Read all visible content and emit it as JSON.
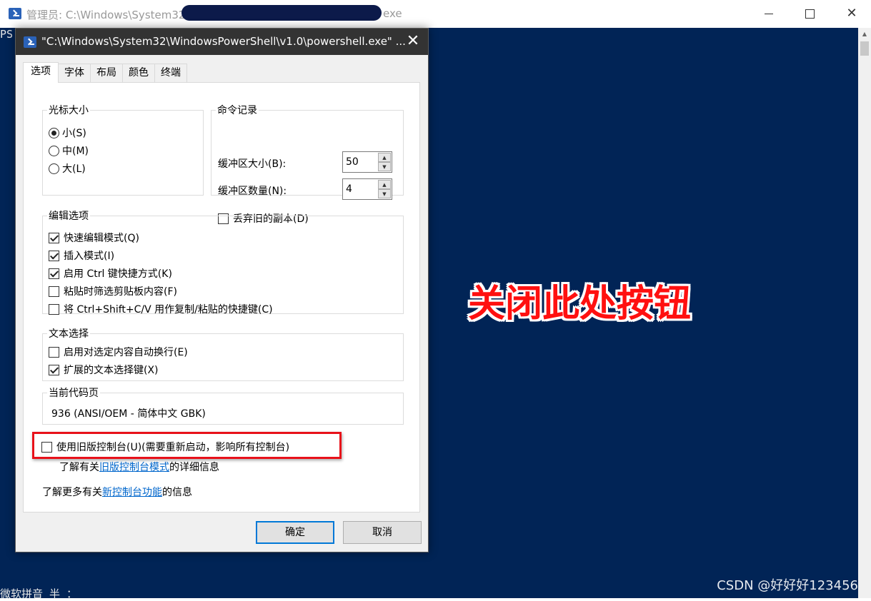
{
  "outer_window": {
    "title_prefix": "管理员: C:\\Windows\\System32",
    "title_suffix": "exe",
    "console_prompt": "PS",
    "console_bottom_line": "微软拼音 半 ：",
    "icon": "powershell-icon"
  },
  "annotation": {
    "callout_text": "关闭此处按钮",
    "color": "#e8111a"
  },
  "watermark": "CSDN @好好好123456",
  "dialog": {
    "title": "\"C:\\Windows\\System32\\WindowsPowerShell\\v1.0\\powershell.exe\" ...",
    "close_glyph": "✕",
    "tabs": [
      {
        "label": "选项",
        "active": true
      },
      {
        "label": "字体",
        "active": false
      },
      {
        "label": "布局",
        "active": false
      },
      {
        "label": "颜色",
        "active": false
      },
      {
        "label": "终端",
        "active": false
      }
    ],
    "cursor_size": {
      "legend": "光标大小",
      "options": [
        {
          "label": "小(S)",
          "selected": true
        },
        {
          "label": "中(M)",
          "selected": false
        },
        {
          "label": "大(L)",
          "selected": false
        }
      ]
    },
    "command_history": {
      "legend": "命令记录",
      "buffer_size_label": "缓冲区大小(B):",
      "buffer_size_value": "50",
      "buffer_count_label": "缓冲区数量(N):",
      "buffer_count_value": "4",
      "discard_label": "丢弃旧的副本(D)",
      "discard_checked": false
    },
    "edit_options": {
      "legend": "编辑选项",
      "items": [
        {
          "label": "快速编辑模式(Q)",
          "checked": true
        },
        {
          "label": "插入模式(I)",
          "checked": true
        },
        {
          "label": "启用 Ctrl 键快捷方式(K)",
          "checked": true
        },
        {
          "label": "粘贴时筛选剪贴板内容(F)",
          "checked": false
        },
        {
          "label": "将 Ctrl+Shift+C/V 用作复制/粘贴的快捷键(C)",
          "checked": false
        }
      ]
    },
    "text_selection": {
      "legend": "文本选择",
      "items": [
        {
          "label": "启用对选定内容自动换行(E)",
          "checked": false
        },
        {
          "label": "扩展的文本选择键(X)",
          "checked": true
        }
      ]
    },
    "codepage": {
      "legend": "当前代码页",
      "value": "936   (ANSI/OEM - 简体中文 GBK)"
    },
    "legacy": {
      "label": "使用旧版控制台(U)(需要重新启动，影响所有控制台)",
      "checked": false,
      "learn_prefix": "了解有关",
      "learn_link": "旧版控制台模式",
      "learn_suffix": "的详细信息"
    },
    "new_features": {
      "prefix": "了解更多有关",
      "link": "新控制台功能",
      "suffix": "的信息"
    },
    "buttons": {
      "ok": "确定",
      "cancel": "取消"
    }
  },
  "colors": {
    "console_bg": "#012456",
    "dialog_bg": "#f0f0f0",
    "dialog_titlebar": "#333333",
    "link": "#0066cc",
    "accent": "#0078d7"
  }
}
